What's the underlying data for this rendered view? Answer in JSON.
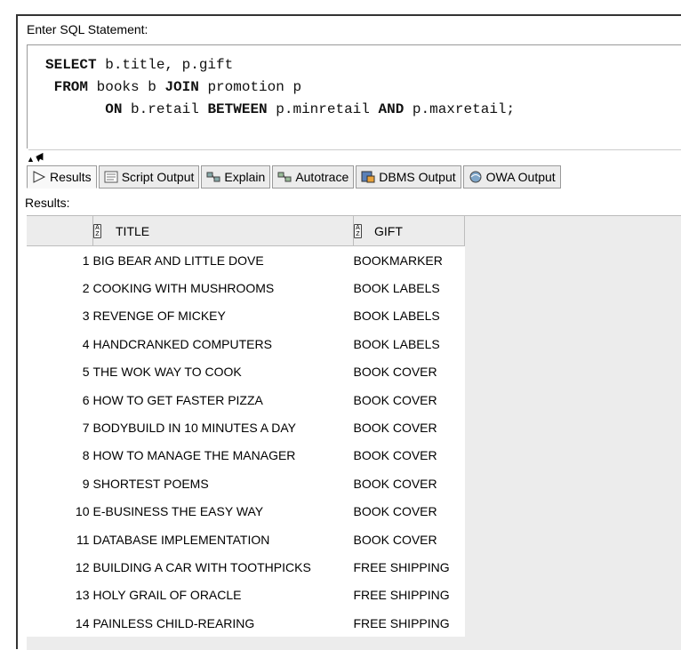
{
  "editor": {
    "label": "Enter SQL Statement:",
    "line1_kw1": "SELECT",
    "line1_rest": " b.title, p.gift",
    "line2_kw1": " FROM",
    "line2_mid": " books b ",
    "line2_kw2": "JOIN",
    "line2_rest": " promotion p",
    "line3_pre": "       ",
    "line3_kw1": "ON",
    "line3_mid1": " b.retail ",
    "line3_kw2": "BETWEEN",
    "line3_mid2": " p.minretail ",
    "line3_kw3": "AND",
    "line3_rest": " p.maxretail;"
  },
  "tabs": [
    {
      "label": "Results",
      "icon": "play-icon"
    },
    {
      "label": "Script Output",
      "icon": "script-icon"
    },
    {
      "label": "Explain",
      "icon": "explain-icon"
    },
    {
      "label": "Autotrace",
      "icon": "autotrace-icon"
    },
    {
      "label": "DBMS Output",
      "icon": "dbms-icon"
    },
    {
      "label": "OWA Output",
      "icon": "owa-icon"
    }
  ],
  "results": {
    "label": "Results:",
    "columns": [
      "TITLE",
      "GIFT"
    ],
    "rows": [
      {
        "n": "1",
        "title": "BIG BEAR AND LITTLE DOVE",
        "gift": "BOOKMARKER"
      },
      {
        "n": "2",
        "title": "COOKING WITH MUSHROOMS",
        "gift": "BOOK LABELS"
      },
      {
        "n": "3",
        "title": "REVENGE OF MICKEY",
        "gift": "BOOK LABELS"
      },
      {
        "n": "4",
        "title": "HANDCRANKED COMPUTERS",
        "gift": "BOOK LABELS"
      },
      {
        "n": "5",
        "title": "THE WOK WAY TO COOK",
        "gift": "BOOK COVER"
      },
      {
        "n": "6",
        "title": "HOW TO GET FASTER PIZZA",
        "gift": "BOOK COVER"
      },
      {
        "n": "7",
        "title": "BODYBUILD IN 10 MINUTES A DAY",
        "gift": "BOOK COVER"
      },
      {
        "n": "8",
        "title": "HOW TO MANAGE THE MANAGER",
        "gift": "BOOK COVER"
      },
      {
        "n": "9",
        "title": "SHORTEST POEMS",
        "gift": "BOOK COVER"
      },
      {
        "n": "10",
        "title": "E-BUSINESS THE EASY WAY",
        "gift": "BOOK COVER"
      },
      {
        "n": "11",
        "title": "DATABASE IMPLEMENTATION",
        "gift": "BOOK COVER"
      },
      {
        "n": "12",
        "title": "BUILDING A CAR WITH TOOTHPICKS",
        "gift": "FREE SHIPPING"
      },
      {
        "n": "13",
        "title": "HOLY GRAIL OF ORACLE",
        "gift": "FREE SHIPPING"
      },
      {
        "n": "14",
        "title": "PAINLESS CHILD-REARING",
        "gift": "FREE SHIPPING"
      }
    ]
  }
}
